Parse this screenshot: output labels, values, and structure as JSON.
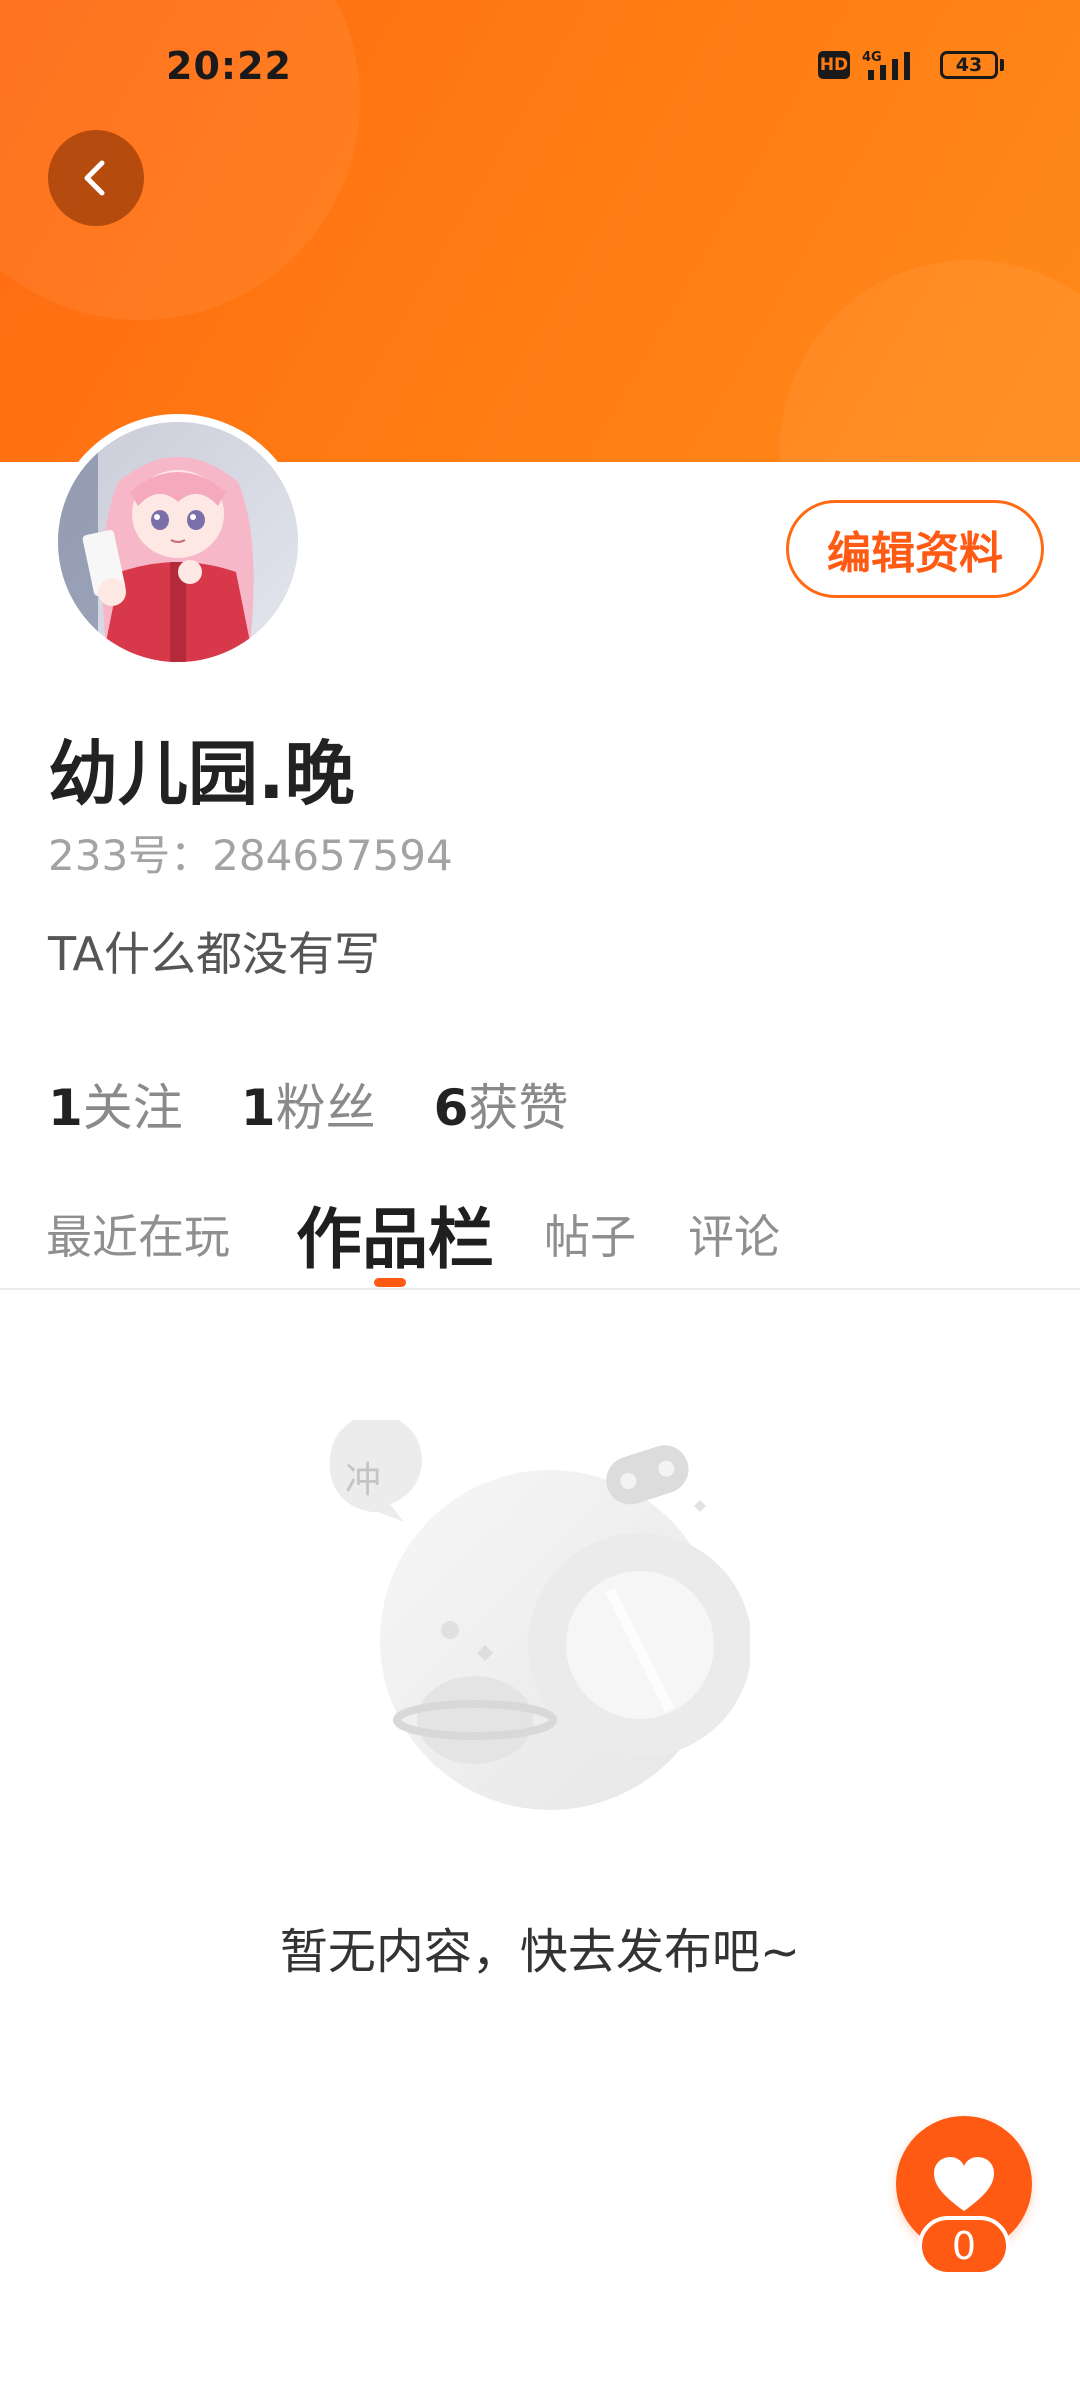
{
  "status_bar": {
    "time": "20:22",
    "hd_label": "HD",
    "network": "4G",
    "battery": "43"
  },
  "header": {
    "back_icon": "chevron-left-icon",
    "banner_color": "#ff7a12"
  },
  "profile": {
    "edit_button_label": "编辑资料",
    "username": "幼儿园.晚",
    "user_id": "233号：284657594",
    "bio": "TA什么都没有写",
    "stats": [
      {
        "num": "1",
        "label": "关注"
      },
      {
        "num": "1",
        "label": "粉丝"
      },
      {
        "num": "6",
        "label": "获赞"
      }
    ]
  },
  "tabs": [
    {
      "label": "最近在玩",
      "active": false
    },
    {
      "label": "作品栏",
      "active": true
    },
    {
      "label": "帖子",
      "active": false
    },
    {
      "label": "评论",
      "active": false
    }
  ],
  "empty_state": {
    "bubble_text": "冲",
    "message": "暂无内容，快去发布吧~"
  },
  "like_fab": {
    "icon": "heart-icon",
    "count": "0"
  },
  "colors": {
    "accent": "#ff5a14"
  }
}
